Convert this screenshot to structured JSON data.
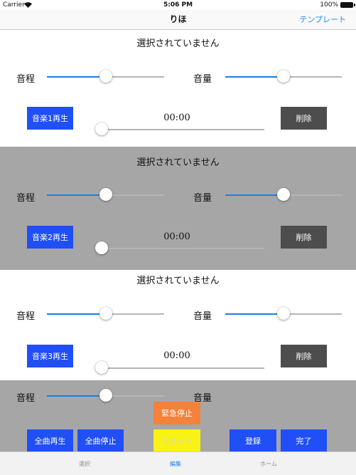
{
  "statusbar": {
    "carrier": "Carrier",
    "time": "5:06 PM",
    "battery": "100%"
  },
  "navbar": {
    "title": "りほ",
    "right_button": "テンプレート"
  },
  "tracks": [
    {
      "status": "選択されていません",
      "pitch_label": "音程",
      "volume_label": "音量",
      "pitch_value": 0.5,
      "volume_value": 0.5,
      "play_label": "音楽1再生",
      "time": "00:00",
      "position_value": 0.0,
      "delete_label": "削除"
    },
    {
      "status": "選択されていません",
      "pitch_label": "音程",
      "volume_label": "音量",
      "pitch_value": 0.5,
      "volume_value": 0.5,
      "play_label": "音楽2再生",
      "time": "00:00",
      "position_value": 0.0,
      "delete_label": "削除"
    },
    {
      "status": "選択されていません",
      "pitch_label": "音程",
      "volume_label": "音量",
      "pitch_value": 0.5,
      "volume_value": 0.5,
      "play_label": "音楽3再生",
      "time": "00:00",
      "position_value": 0.0,
      "delete_label": "削除"
    }
  ],
  "master": {
    "pitch_label": "音程",
    "volume_label": "音量",
    "pitch_value": 0.5,
    "emergency_stop": "緊急停止",
    "play_all": "全曲再生",
    "stop_all": "全曲停止",
    "reset": "リセット",
    "register": "登録",
    "done": "完了"
  },
  "tabbar": {
    "tabs": [
      "選択",
      "編集",
      "ホーム"
    ],
    "active_index": 1
  },
  "colors": {
    "accent": "#1a7fe8",
    "button_blue": "#1f4ff5",
    "delete_gray": "#4d4d4d",
    "panel_gray": "#a6a6a6",
    "orange": "#f5813a",
    "yellow": "#f8f314"
  }
}
